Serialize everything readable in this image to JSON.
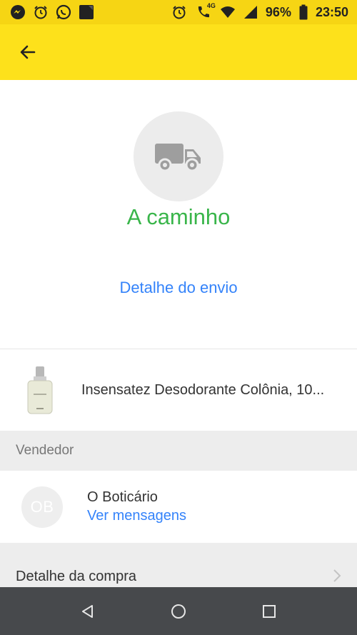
{
  "status_bar": {
    "battery_percent": "96%",
    "time": "23:50",
    "network_label": "4G",
    "left_icons": [
      "messenger-icon",
      "alarm-icon",
      "whatsapp-icon",
      "square-app-icon"
    ],
    "right_icons": [
      "alarm-icon",
      "call-4g-icon",
      "wifi-icon",
      "signal-icon",
      "battery-icon"
    ]
  },
  "app_bar": {
    "back_icon": "arrow-left-icon",
    "color": "#fde11b"
  },
  "shipment": {
    "icon": "truck-icon",
    "status": "A caminho",
    "status_color": "#39b54a",
    "detail_link": "Detalhe do envio"
  },
  "product": {
    "name": "Insensatez Desodorante Colônia, 10...",
    "thumbnail": "product-bottle-image"
  },
  "seller_section": {
    "header": "Vendedor",
    "avatar_initials": "OB",
    "name": "O Boticário",
    "messages_link": "Ver mensagens"
  },
  "purchase": {
    "label": "Detalhe da compra",
    "chevron_icon": "chevron-right-icon"
  },
  "nav_bar": {
    "buttons": [
      "back-triangle-icon",
      "home-circle-icon",
      "recents-square-icon"
    ]
  },
  "colors": {
    "accent_blue": "#3483fa",
    "brand_yellow": "#fde11b",
    "status_green": "#39b54a"
  }
}
